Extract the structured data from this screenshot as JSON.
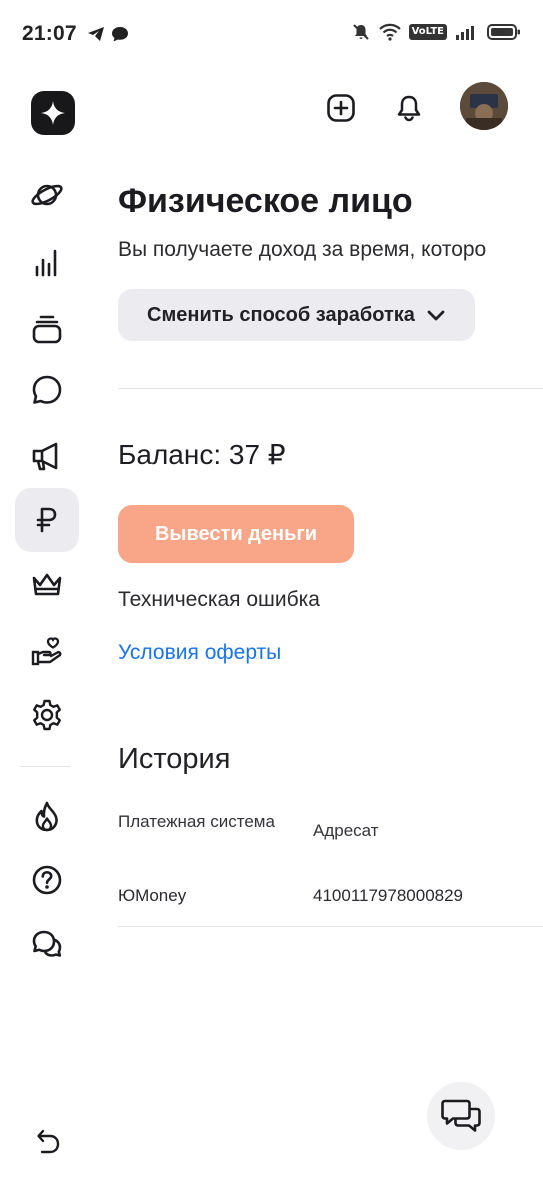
{
  "status_bar": {
    "time": "21:07",
    "volte": "VoLTE"
  },
  "header": {
    "logo_icon": "sparkle-icon",
    "add_icon": "plus-square-icon",
    "bell_icon": "bell-icon",
    "avatar_icon": "user-avatar"
  },
  "sidebar": {
    "items": [
      {
        "icon": "planet-icon"
      },
      {
        "icon": "bar-chart-icon"
      },
      {
        "icon": "layers-icon"
      },
      {
        "icon": "chat-bubble-icon"
      },
      {
        "icon": "megaphone-icon"
      },
      {
        "icon": "ruble-icon",
        "active": true
      },
      {
        "icon": "crown-icon"
      },
      {
        "icon": "hand-heart-icon"
      },
      {
        "icon": "gear-icon"
      },
      {
        "icon": "flame-icon"
      },
      {
        "icon": "help-circle-icon"
      },
      {
        "icon": "chats-icon"
      }
    ],
    "back_icon": "back-arrow-icon"
  },
  "main": {
    "title": "Физическое лицо",
    "description": "Вы получаете доход за время, которо",
    "switch_button": "Сменить способ заработка",
    "balance": "Баланс: 37 ₽",
    "withdraw_button": "Вывести деньги",
    "error_text": "Техническая ошибка",
    "offer_link": "Условия оферты",
    "history": {
      "title": "История",
      "columns": [
        "Платежная система",
        "Адресат"
      ],
      "rows": [
        [
          "ЮMoney",
          "4100117978000829"
        ]
      ]
    }
  },
  "colors": {
    "accent_button": "#f9a588",
    "link": "#1a73e8",
    "active_nav_bg": "#ececf0"
  }
}
